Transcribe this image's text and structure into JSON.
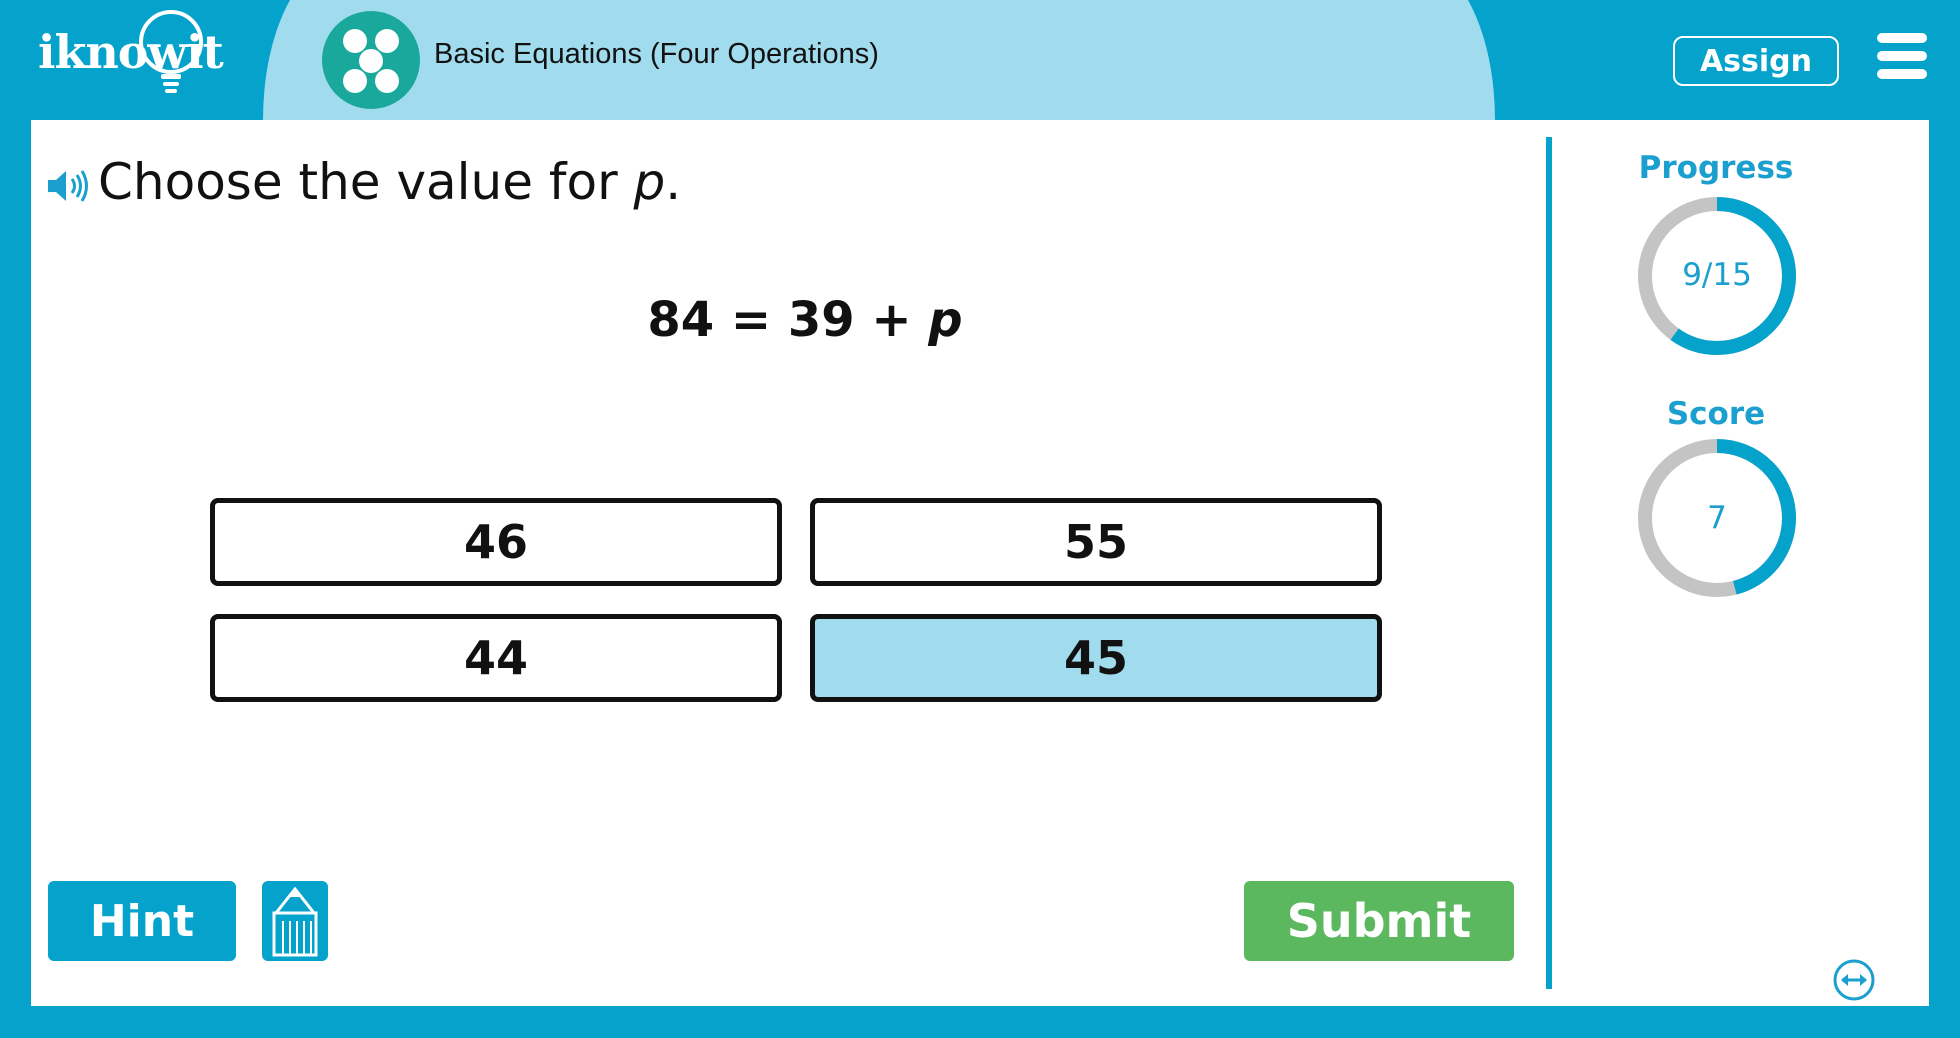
{
  "brand": {
    "logo_text": "iknowit"
  },
  "header": {
    "topic_title": "Basic Equations (Four Operations)",
    "assign_label": "Assign"
  },
  "question": {
    "prompt_text": "Choose the value for ",
    "prompt_var": "p",
    "prompt_end": ".",
    "equation_text": "84 = 39 + ",
    "equation_var": "p"
  },
  "choices": [
    {
      "label": "46",
      "selected": false
    },
    {
      "label": "55",
      "selected": false
    },
    {
      "label": "44",
      "selected": false
    },
    {
      "label": "45",
      "selected": true
    }
  ],
  "buttons": {
    "hint_label": "Hint",
    "submit_label": "Submit"
  },
  "sidebar": {
    "progress_label": "Progress",
    "progress_text": "9/15",
    "progress_fraction": 0.6,
    "score_label": "Score",
    "score_text": "7",
    "score_fraction": 0.46
  },
  "colors": {
    "accent": "#05a2cc",
    "pill": "#a1dcee",
    "submit": "#5bb85e",
    "ring_track": "#c4c4c4",
    "selected_choice": "#a1dcee"
  }
}
